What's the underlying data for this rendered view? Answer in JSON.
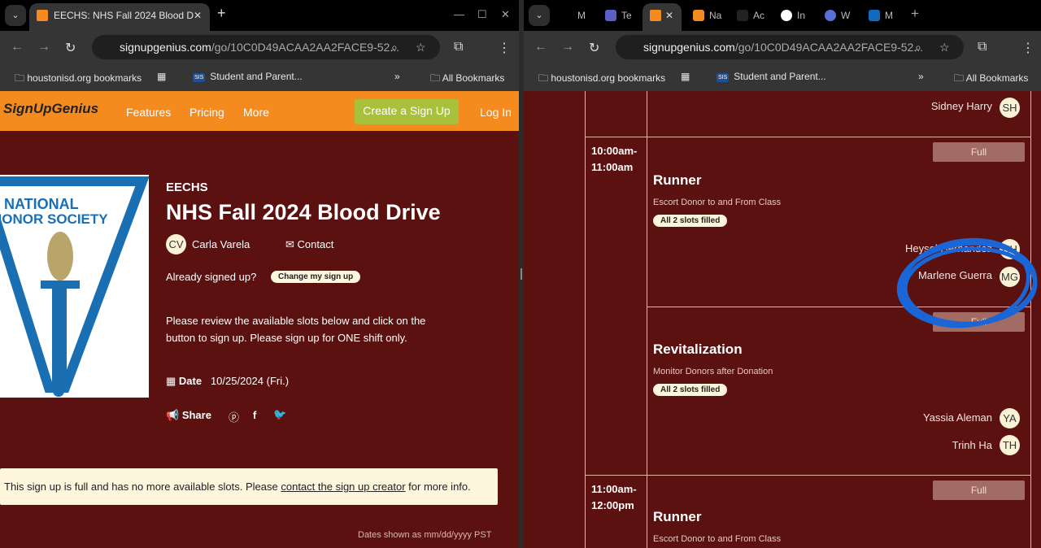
{
  "left": {
    "tab_title": "EECHS: NHS Fall 2024 Blood D",
    "url_host": "signupgenius.com",
    "url_path": "/go/10C0D49ACAA2AA2FACE9-52...",
    "bookmarks": [
      "houstonisd.org bookmarks",
      "Student and Parent...",
      "All Bookmarks"
    ],
    "sis": "SIS",
    "site": {
      "logo": "SignUpGenius",
      "nav": [
        "Features",
        "Pricing",
        "More"
      ],
      "create": "Create a Sign Up",
      "login": "Log In"
    },
    "logo_text": "NATIONAL HONOR SOCIETY",
    "org": "EECHS",
    "title": "NHS Fall 2024 Blood Drive",
    "creator_initials": "CV",
    "creator": "Carla Varela",
    "contact": "Contact",
    "already": "Already signed up?",
    "change": "Change my sign up",
    "instructions": "Please review the available slots below and click on the button to sign up. Please sign up for ONE shift only.",
    "date_label": "Date",
    "date_value": "10/25/2024 (Fri.)",
    "share": "Share",
    "notice_pre": "This sign up is full and has no more available slots. Please ",
    "notice_link": "contact the sign up creator",
    "notice_post": " for more info.",
    "dates_note": "Dates shown as mm/dd/yyyy PST"
  },
  "right": {
    "tabs": [
      "M",
      "Te",
      "Na",
      "Ac",
      "In",
      "W",
      "M"
    ],
    "url_host": "signupgenius.com",
    "url_path": "/go/10C0D49ACAA2AA2FACE9-52...",
    "bookmarks": [
      "houstonisd.org bookmarks",
      "Student and Parent...",
      "All Bookmarks"
    ],
    "sis": "SIS",
    "top_person": {
      "name": "Sidney Harry",
      "initials": "SH"
    },
    "slots": [
      {
        "time": [
          "10:00am-",
          "11:00am"
        ],
        "full": "Full",
        "role": "Runner",
        "desc": "Escort Donor to and From Class",
        "badge": "All 2 slots filled",
        "people": [
          {
            "name": "Heysel Hernandez",
            "initials": "HH"
          },
          {
            "name": "Marlene Guerra",
            "initials": "MG"
          }
        ]
      },
      {
        "full": "Full",
        "role": "Revitalization",
        "desc": "Monitor Donors after Donation",
        "badge": "All 2 slots filled",
        "people": [
          {
            "name": "Yassia Aleman",
            "initials": "YA"
          },
          {
            "name": "Trinh Ha",
            "initials": "TH"
          }
        ]
      },
      {
        "time": [
          "11:00am-",
          "12:00pm"
        ],
        "full": "Full",
        "role": "Runner",
        "desc": "Escort Donor to and From Class"
      }
    ]
  },
  "colors": {
    "bg": "#5c1111",
    "orange": "#f58a1f",
    "green": "#a8c03a",
    "annotation": "#1a66d6"
  }
}
